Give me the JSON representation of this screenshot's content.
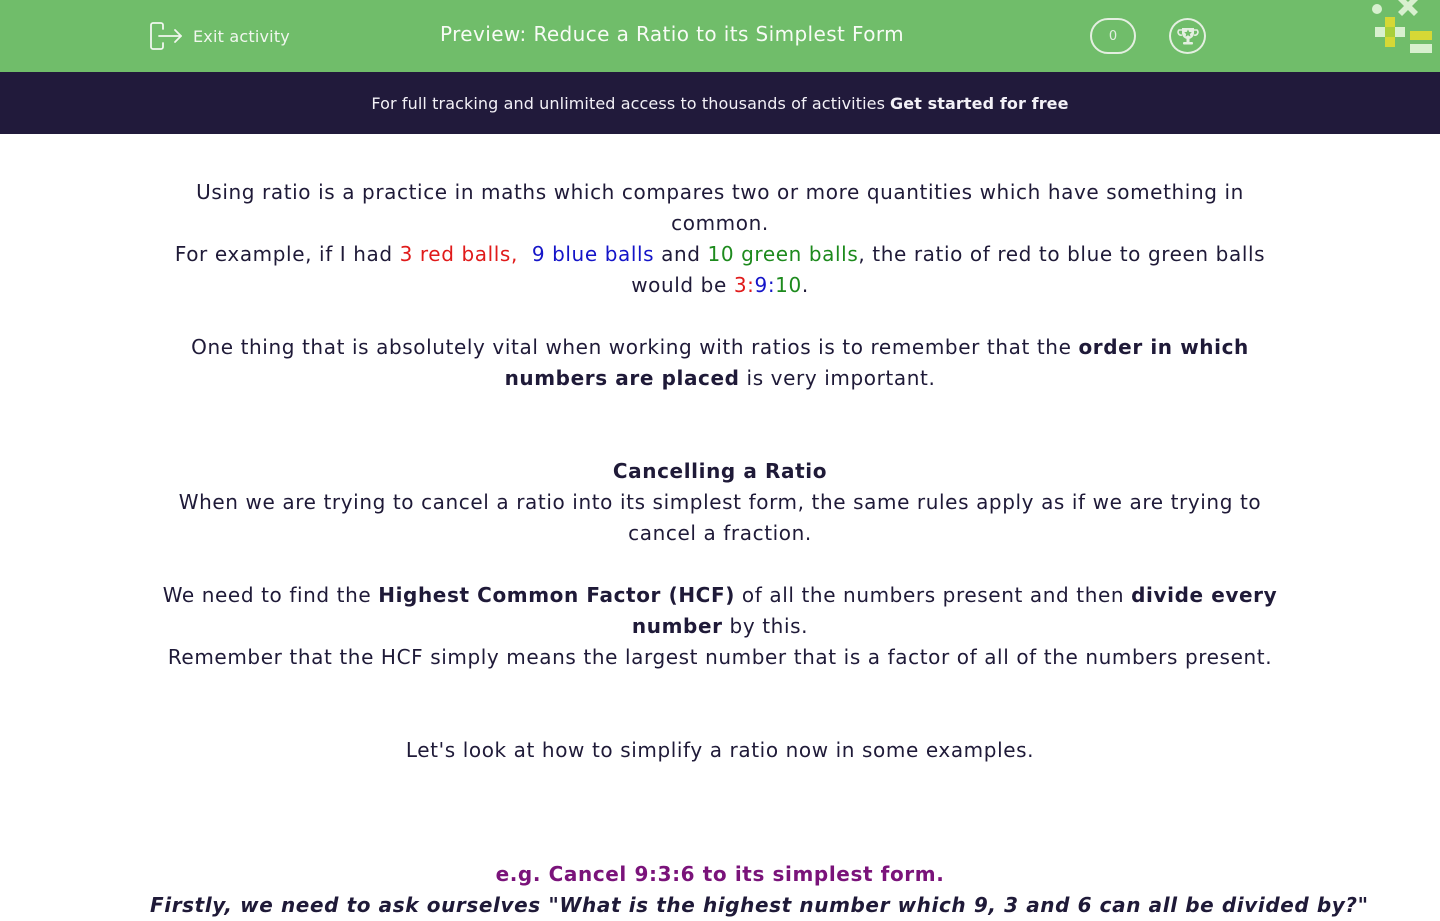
{
  "header": {
    "exit_label": "Exit activity",
    "title": "Preview: Reduce a Ratio to its Simplest Form",
    "score": "0",
    "colors": {
      "bar": "#70bd6a",
      "banner": "#211a3b"
    }
  },
  "banner": {
    "text": "For full tracking and unlimited access to thousands of activities",
    "cta": "Get started for free"
  },
  "content": {
    "intro": "Using ratio is a practice in maths which compares two or more quantities which have something in common.",
    "example": {
      "prefix": "For example, if I had ",
      "red": "3 red balls,",
      "sep": "  ",
      "blue": "9 blue balls",
      "mid": " and ",
      "green": "10 green balls",
      "suffix": ", the ratio of red to blue to green balls would be ",
      "r1": "3",
      "c1": ":",
      "r2": "9",
      "c2": ":",
      "r3": "10",
      "end": "."
    },
    "order": {
      "prefix": "One thing that is absolutely vital when working with ratios is to remember that the ",
      "bold": "order in which numbers are placed",
      "suffix": " is very important."
    },
    "heading": "Cancelling a Ratio",
    "cancel_text": "When we are trying to cancel a ratio into its simplest form, the same rules apply as if we are trying to cancel a fraction.",
    "hcf": {
      "prefix": "We need to find the ",
      "bold1": "Highest Common Factor (HCF)",
      "mid": " of all the numbers present and then ",
      "bold2": "divide every number",
      "suffix": " by this."
    },
    "remember": "Remember that the HCF simply means the largest number that is a factor of all of the numbers present.",
    "examples_intro": "Let's look at how to simplify a ratio now in some examples.",
    "example_heading": "e.g. Cancel 9:3:6 to its simplest form.",
    "cut_line": "Firstly, we need to ask ourselves \"What is the highest number which 9, 3 and 6 can all be divided by?\""
  }
}
